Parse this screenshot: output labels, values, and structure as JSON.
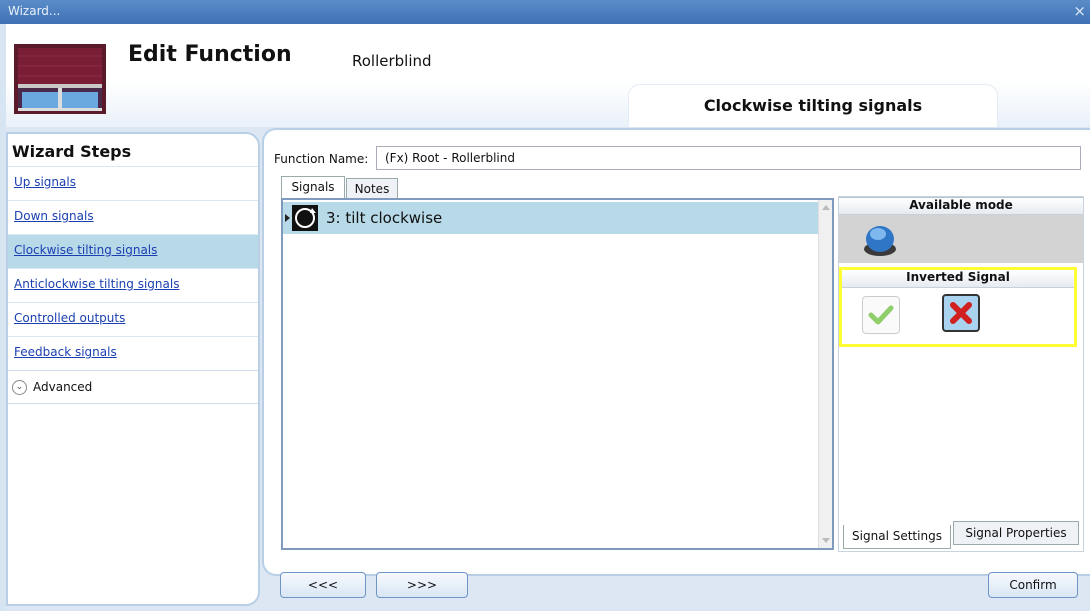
{
  "window": {
    "title": "Wizard...",
    "close_glyph": "×"
  },
  "header": {
    "title": "Edit Function",
    "subtitle": "Rollerblind",
    "step_title": "Clockwise tilting signals",
    "logo_icon": "rollerblind-icon"
  },
  "sidebar": {
    "heading": "Wizard Steps",
    "items": [
      {
        "label": "Up signals",
        "active": false
      },
      {
        "label": "Down signals",
        "active": false
      },
      {
        "label": "Clockwise tilting signals",
        "active": true
      },
      {
        "label": "Anticlockwise tilting signals",
        "active": false
      },
      {
        "label": "Controlled outputs",
        "active": false
      },
      {
        "label": "Feedback signals",
        "active": false
      }
    ],
    "advanced_label": "Advanced"
  },
  "main": {
    "function_name_label": "Function Name:",
    "function_name_value": "(Fx) Root - Rollerblind",
    "tabs": [
      {
        "label": "Signals",
        "selected": true
      },
      {
        "label": "Notes",
        "selected": false
      }
    ],
    "signals": [
      {
        "label": "3: tilt clockwise",
        "icon": "tilt-clockwise-icon",
        "selected": true
      }
    ]
  },
  "right_panel": {
    "available_mode_title": "Available mode",
    "mode_icon": "pushbutton-icon",
    "inverted_signal_title": "Inverted Signal",
    "inverted_options": [
      {
        "icon": "check-icon",
        "selected": false
      },
      {
        "icon": "cross-icon",
        "selected": true
      }
    ],
    "tabs": [
      {
        "label": "Signal Settings",
        "selected": true
      },
      {
        "label": "Signal Properties",
        "selected": false
      }
    ]
  },
  "footer": {
    "prev_label": "<<<",
    "next_label": ">>>",
    "confirm_label": "Confirm"
  },
  "colors": {
    "titlebar": "#4a7ebf",
    "selected_row": "#b7d9e8",
    "highlight_border": "#ffff33",
    "link": "#1a3fb0"
  }
}
